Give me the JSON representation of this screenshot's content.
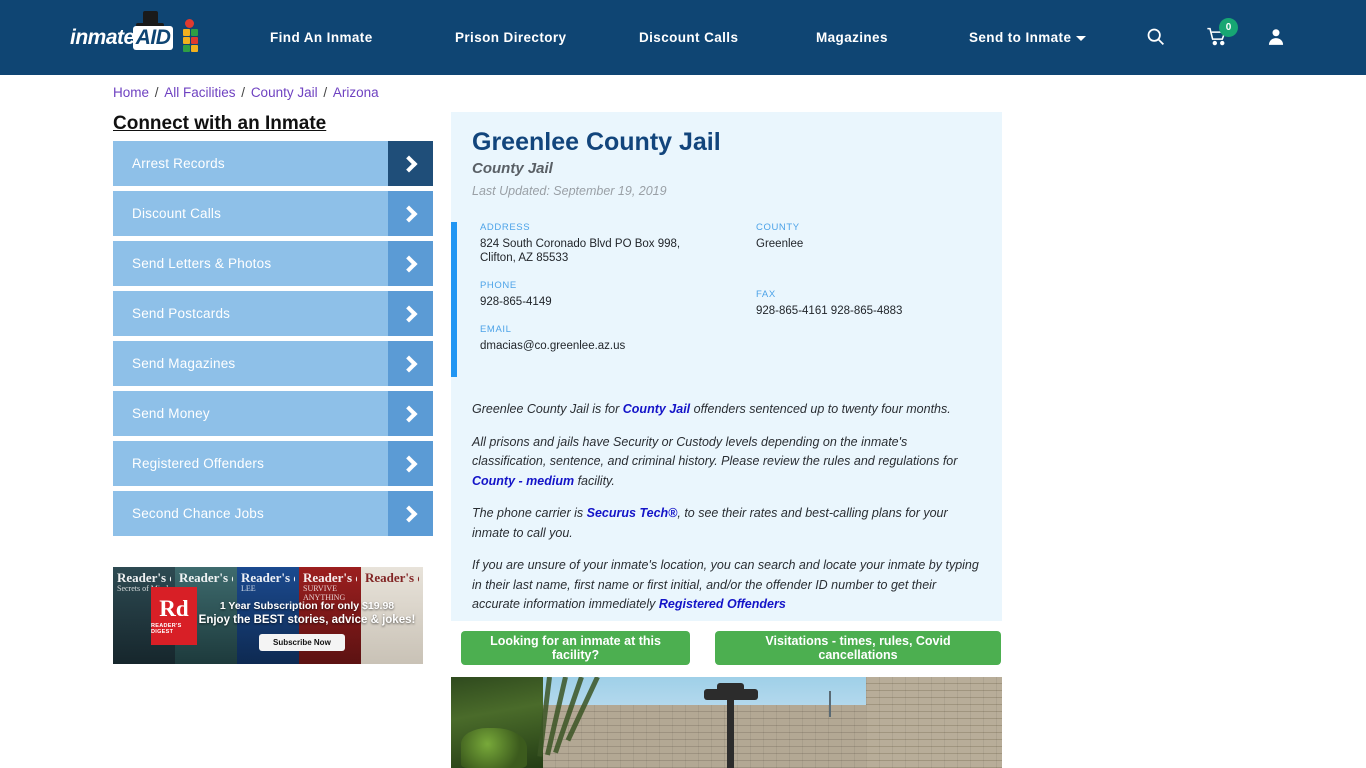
{
  "header": {
    "logo_text": "inmate",
    "logo_accent": "AID",
    "nav": [
      {
        "label": "Find An Inmate"
      },
      {
        "label": "Prison Directory"
      },
      {
        "label": "Discount Calls"
      },
      {
        "label": "Magazines"
      },
      {
        "label": "Send to Inmate"
      }
    ],
    "icons": {
      "search": "search-icon",
      "cart": "cart-icon",
      "cart_count": "0",
      "account": "user-icon"
    },
    "background_color": "#0f4573"
  },
  "breadcrumb": {
    "items": [
      "Home",
      "All Facilities",
      "County Jail",
      "Arizona"
    ],
    "separator": "/"
  },
  "sidebar": {
    "title": "Connect with an Inmate",
    "items": [
      {
        "label": "Arrest Records"
      },
      {
        "label": "Discount Calls"
      },
      {
        "label": "Send Letters & Photos"
      },
      {
        "label": "Send Postcards"
      },
      {
        "label": "Send Magazines"
      },
      {
        "label": "Send Money"
      },
      {
        "label": "Registered Offenders"
      },
      {
        "label": "Second Chance Jobs"
      }
    ]
  },
  "ad": {
    "magazine_titles": [
      "Reader's digest",
      "Reader's digest",
      "Reader's digest",
      "Reader's digest",
      "Reader's digest"
    ],
    "strip_subs": [
      "Secrets of Mind",
      "",
      "LEE",
      "SURVIVE ANYTHING",
      ""
    ],
    "logo_top": "Rd",
    "logo_bottom": "READER'S DIGEST",
    "line1": "1 Year Subscription for only $19.98",
    "line2": "Enjoy the BEST stories, advice & jokes!",
    "cta": "Subscribe Now"
  },
  "facility": {
    "name": "Greenlee County Jail",
    "type": "County Jail",
    "last_updated": "Last Updated: September 19, 2019",
    "fields": {
      "address_label": "ADDRESS",
      "address_line1": "824 South Coronado Blvd PO Box 998,",
      "address_line2": "Clifton, AZ 85533",
      "county_label": "COUNTY",
      "county_value": "Greenlee",
      "phone_label": "PHONE",
      "phone_value": "928-865-4149",
      "fax_label": "FAX",
      "fax_value": "928-865-4161 928-865-4883",
      "email_label": "EMAIL",
      "email_value": "dmacias@co.greenlee.az.us"
    },
    "paragraphs": {
      "p1_a": "Greenlee County Jail is for ",
      "p1_link": "County Jail",
      "p1_b": " offenders sentenced up to twenty four months.",
      "p2_a": "All prisons and jails have Security or Custody levels depending on the inmate's classification, sentence, and criminal history. Please review the rules and regulations for ",
      "p2_link": "County - medium",
      "p2_b": " facility.",
      "p3_a": "The phone carrier is ",
      "p3_link": "Securus Tech®",
      "p3_b": ", to see their rates and best-calling plans for your inmate to call you.",
      "p4_a": "If you are unsure of your inmate's location, you can search and locate your inmate by typing in their last name, first name or first initial, and/or the offender ID number to get their accurate information immediately ",
      "p4_link": "Registered Offenders"
    }
  },
  "actions": {
    "find_inmate": "Looking for an inmate at this facility?",
    "visitations": "Visitations - times, rules, Covid cancellations",
    "button_color": "#4caf50"
  },
  "colors": {
    "header_blue": "#0f4573",
    "card_blue": "#eaf6fd",
    "accent_bar": "#2196f3",
    "sidebar_btn": "#8ec0e8",
    "sidebar_arrow": "#5b9bd5",
    "sidebar_arrow_active": "#1f4e79",
    "link_purple": "#6f42c1",
    "link_blue": "#1414c8",
    "title_blue": "#12457c",
    "badge_green": "#17a673"
  }
}
